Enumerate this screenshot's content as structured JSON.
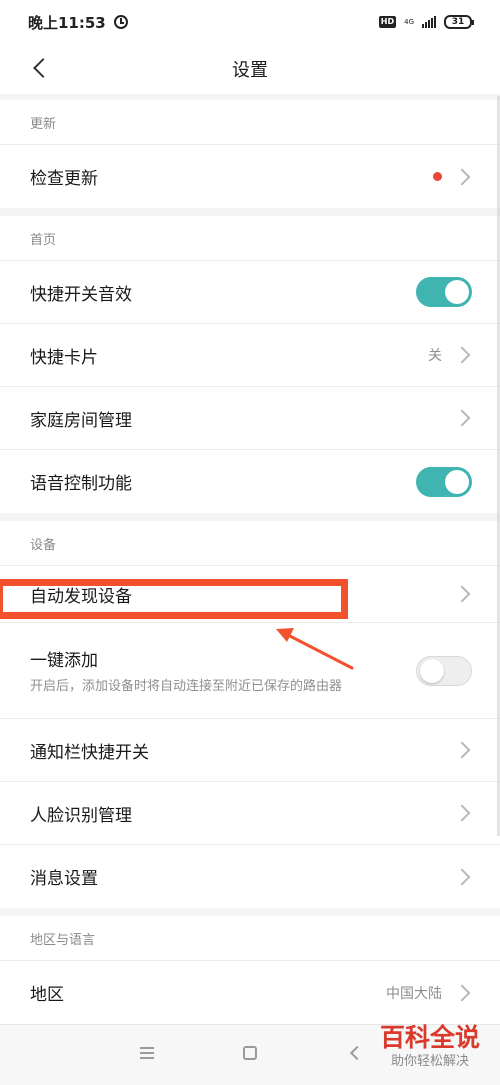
{
  "status_bar": {
    "time": "晚上11:53",
    "hd": "HD",
    "network": "4G",
    "battery": "31"
  },
  "header": {
    "title": "设置"
  },
  "sections": [
    {
      "title": "更新",
      "items": [
        {
          "label": "检查更新",
          "badge": true
        }
      ]
    },
    {
      "title": "首页",
      "items": [
        {
          "label": "快捷开关音效",
          "toggle": "on"
        },
        {
          "label": "快捷卡片",
          "value": "关"
        },
        {
          "label": "家庭房间管理"
        },
        {
          "label": "语音控制功能",
          "toggle": "on"
        }
      ]
    },
    {
      "title": "设备",
      "items": [
        {
          "label": "自动发现设备"
        },
        {
          "label": "一键添加",
          "description": "开启后，添加设备时将自动连接至附近已保存的路由器",
          "toggle": "off"
        },
        {
          "label": "通知栏快捷开关"
        },
        {
          "label": "人脸识别管理"
        },
        {
          "label": "消息设置"
        }
      ]
    },
    {
      "title": "地区与语言",
      "items": [
        {
          "label": "地区",
          "value": "中国大陆"
        }
      ]
    }
  ],
  "watermark": {
    "title": "百科全说",
    "subtitle": "助你轻松解决"
  },
  "colors": {
    "toggle_on": "#3fb4b1",
    "badge": "#e9473b",
    "highlight": "#f2512d",
    "watermark": "#d93a2b"
  }
}
